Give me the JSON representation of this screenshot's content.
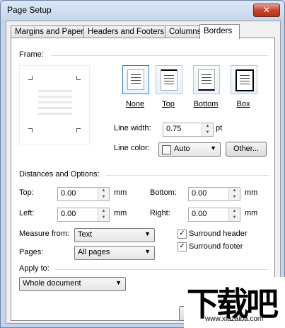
{
  "window": {
    "title": "Page Setup",
    "close": "✕"
  },
  "tabs": [
    "Margins and Paper",
    "Headers and Footers",
    "Columns",
    "Borders"
  ],
  "frame": {
    "label": "Frame:",
    "buttons": [
      "None",
      "Top",
      "Bottom",
      "Box"
    ],
    "line_width_label": "Line width:",
    "line_width_value": "0.75",
    "line_width_unit": "pt",
    "line_color_label": "Line color:",
    "line_color_value": "Auto",
    "other_button": "Other..."
  },
  "distances": {
    "label": "Distances and Options:",
    "top_label": "Top:",
    "top_value": "0.00",
    "left_label": "Left:",
    "left_value": "0.00",
    "bottom_label": "Bottom:",
    "bottom_value": "0.00",
    "right_label": "Right:",
    "right_value": "0.00",
    "unit": "mm",
    "measure_from_label": "Measure from:",
    "measure_from_value": "Text",
    "pages_label": "Pages:",
    "pages_value": "All pages",
    "surround_header": "Surround header",
    "surround_footer": "Surround footer"
  },
  "apply": {
    "label": "Apply to:",
    "value": "Whole document"
  },
  "watermark": {
    "glyphs": "下载吧",
    "url": "www.xiazaiba.com"
  }
}
